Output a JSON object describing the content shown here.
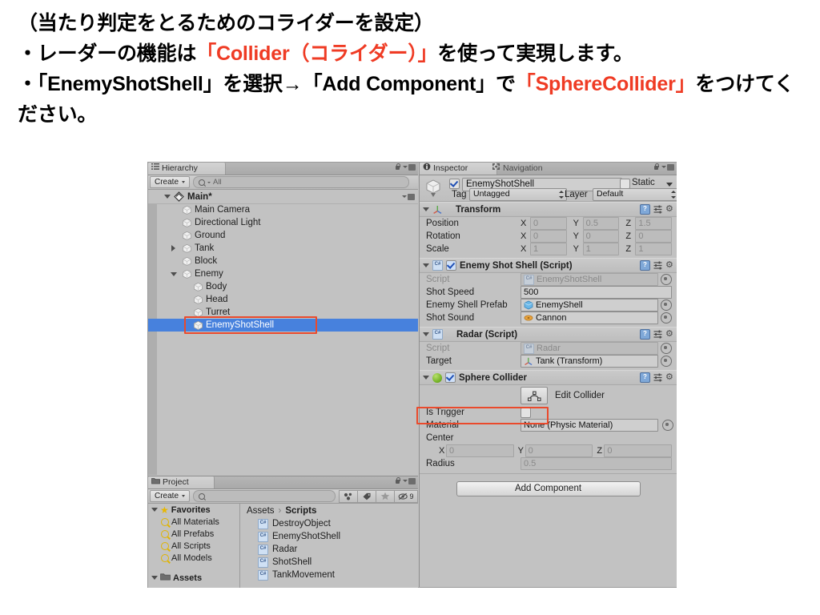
{
  "slide": {
    "line1": "（当たり判定をとるためのコライダーを設定）",
    "line2_a": "・レーダーの機能は",
    "line2_hl": "「Collider（コライダー）」",
    "line2_b": "を使って実現します。",
    "line3_a": "・「EnemyShotShell」を選択→「Add Component」で",
    "line3_hl": "「Sphere",
    "line4_hl": "Collider」",
    "line4_b": "をつけてください。",
    "highlight_color": "#ef3b24"
  },
  "hierarchy": {
    "tab_label": "Hierarchy",
    "create_label": "Create",
    "search_placeholder": "All",
    "search_value": "All",
    "root": "Main*",
    "items": [
      {
        "label": "Main Camera",
        "indent": 2,
        "arrow": "none",
        "selected": false
      },
      {
        "label": "Directional Light",
        "indent": 2,
        "arrow": "none",
        "selected": false
      },
      {
        "label": "Ground",
        "indent": 2,
        "arrow": "none",
        "selected": false
      },
      {
        "label": "Tank",
        "indent": 2,
        "arrow": "collapsed",
        "selected": false
      },
      {
        "label": "Block",
        "indent": 2,
        "arrow": "none",
        "selected": false
      },
      {
        "label": "Enemy",
        "indent": 2,
        "arrow": "expanded",
        "selected": false
      },
      {
        "label": "Body",
        "indent": 3,
        "arrow": "none",
        "selected": false
      },
      {
        "label": "Head",
        "indent": 3,
        "arrow": "none",
        "selected": false
      },
      {
        "label": "Turret",
        "indent": 3,
        "arrow": "none",
        "selected": false
      },
      {
        "label": "EnemyShotShell",
        "indent": 3,
        "arrow": "none",
        "selected": true
      }
    ]
  },
  "project": {
    "tab_label": "Project",
    "create_label": "Create",
    "search_placeholder": "",
    "search_value": "",
    "hidden_count": "9",
    "favorites_label": "Favorites",
    "favorites": [
      "All Materials",
      "All Prefabs",
      "All Scripts",
      "All Models"
    ],
    "assets_label": "Assets",
    "breadcrumb": [
      "Assets",
      "Scripts"
    ],
    "files": [
      "DestroyObject",
      "EnemyShotShell",
      "Radar",
      "ShotShell",
      "TankMovement"
    ]
  },
  "inspector": {
    "tab_label": "Inspector",
    "tab2_label": "Navigation",
    "object": {
      "enabled": true,
      "name": "EnemyShotShell",
      "static_label": "Static",
      "static_checked": false,
      "tag_label": "Tag",
      "tag_value": "Untagged",
      "layer_label": "Layer",
      "layer_value": "Default"
    },
    "transform": {
      "title": "Transform",
      "rows": [
        {
          "label": "Position",
          "x": "0",
          "y": "0.5",
          "z": "1.5"
        },
        {
          "label": "Rotation",
          "x": "0",
          "y": "0",
          "z": "0"
        },
        {
          "label": "Scale",
          "x": "1",
          "y": "1",
          "z": "1"
        }
      ],
      "axis_labels": [
        "X",
        "Y",
        "Z"
      ]
    },
    "enemy_shot_shell": {
      "title": "Enemy Shot Shell (Script)",
      "enabled": true,
      "rows": [
        {
          "label": "Script",
          "value": "EnemyShotShell",
          "dim": true,
          "icon": "cs-icon",
          "picker": true
        },
        {
          "label": "Shot Speed",
          "value": "500",
          "dim": false,
          "icon": "none",
          "picker": false
        },
        {
          "label": "Enemy Shell Prefab",
          "value": "EnemyShell",
          "dim": false,
          "icon": "prefab-icon",
          "picker": true
        },
        {
          "label": "Shot Sound",
          "value": "Cannon",
          "dim": false,
          "icon": "audio-icon",
          "picker": true
        }
      ]
    },
    "radar": {
      "title": "Radar (Script)",
      "rows": [
        {
          "label": "Script",
          "value": "Radar",
          "dim": true,
          "icon": "cs-icon",
          "picker": true
        },
        {
          "label": "Target",
          "value": "Tank (Transform)",
          "dim": false,
          "icon": "transform-icon",
          "picker": true
        }
      ]
    },
    "sphere_collider": {
      "title": "Sphere Collider",
      "enabled": true,
      "edit_collider_label": "Edit Collider",
      "is_trigger_label": "Is Trigger",
      "is_trigger_checked": false,
      "material_label": "Material",
      "material_value": "None (Physic Material)",
      "center_label": "Center",
      "center": {
        "x": "0",
        "y": "0",
        "z": "0"
      },
      "axis_labels": [
        "X",
        "Y",
        "Z"
      ],
      "radius_label": "Radius",
      "radius_value": "0.5"
    },
    "add_component_label": "Add Component"
  }
}
